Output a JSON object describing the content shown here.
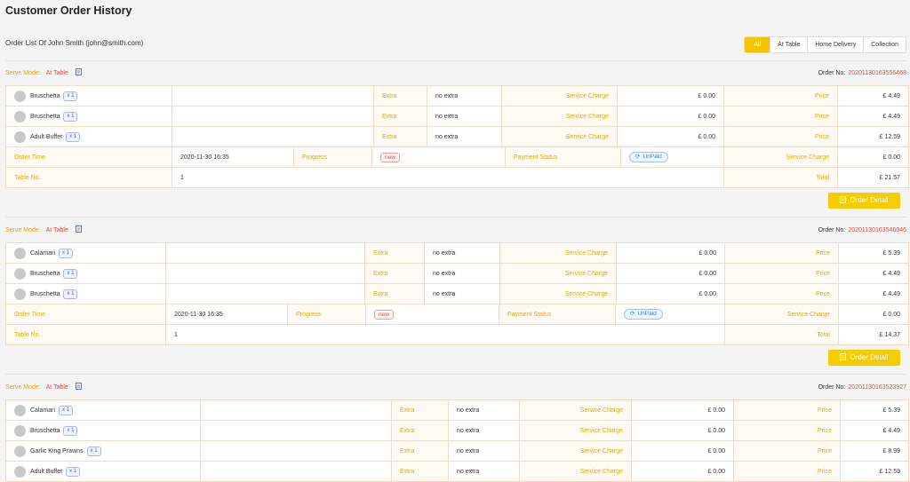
{
  "page": {
    "title": "Customer Order History",
    "subtitle": "Order List Of John Smith (john@smith.com)"
  },
  "filters": [
    {
      "label": "All",
      "active": true
    },
    {
      "label": "At Table",
      "active": false
    },
    {
      "label": "Home Delivery",
      "active": false
    },
    {
      "label": "Collection",
      "active": false
    }
  ],
  "labels": {
    "serve_mode": "Serve Mode:",
    "order_no": "Order No:",
    "extra": "Extra",
    "service_charge": "Service Charge",
    "price": "Price",
    "order_time": "Order Time",
    "progress": "Progress",
    "payment_status": "Payment Status",
    "table_no": "Table No.",
    "total": "Total",
    "order_detail": "Order Detail"
  },
  "icons": {
    "serve_mode": "document-icon",
    "order_detail": "document-icon",
    "unpaid": "refresh-icon",
    "item": "avatar-placeholder-icon"
  },
  "colors": {
    "accent": "#f5cc00",
    "label": "#e6a800",
    "highlight": "#e84a3a",
    "border": "#f0c9a4"
  },
  "orders": [
    {
      "serve_mode": "At Table",
      "order_no": "20201130163556468",
      "items": [
        {
          "name": "Bruschetta",
          "qty": "x 1",
          "extra": "no extra",
          "service_charge": "£ 0.00",
          "price": "£ 4.49"
        },
        {
          "name": "Bruschetta",
          "qty": "x 1",
          "extra": "no extra",
          "service_charge": "£ 0.00",
          "price": "£ 4.49"
        },
        {
          "name": "Adult Buffet",
          "qty": "x 1",
          "extra": "no extra",
          "service_charge": "£ 0.00",
          "price": "£ 12.59"
        }
      ],
      "order_time": "2020-11-30 16:35",
      "progress": "new",
      "payment_status": "UnPaid",
      "service_charge_total": "£ 0.00",
      "table_no": "1",
      "total": "£ 21.57"
    },
    {
      "serve_mode": "At Table",
      "order_no": "20201130163546046",
      "items": [
        {
          "name": "Calamari",
          "qty": "x 1",
          "extra": "no extra",
          "service_charge": "£ 0.00",
          "price": "£ 5.39"
        },
        {
          "name": "Bruschetta",
          "qty": "x 1",
          "extra": "no extra",
          "service_charge": "£ 0.00",
          "price": "£ 4.49"
        },
        {
          "name": "Bruschetta",
          "qty": "x 1",
          "extra": "no extra",
          "service_charge": "£ 0.00",
          "price": "£ 4.49"
        }
      ],
      "order_time": "2020-11-30 16:35",
      "progress": "new",
      "payment_status": "UnPaid",
      "service_charge_total": "£ 0.00",
      "table_no": "1",
      "total": "£ 14.37"
    },
    {
      "serve_mode": "At Table",
      "order_no": "20201130163523927",
      "items": [
        {
          "name": "Calamari",
          "qty": "x 1",
          "extra": "no extra",
          "service_charge": "£ 0.00",
          "price": "£ 5.39"
        },
        {
          "name": "Bruschetta",
          "qty": "x 1",
          "extra": "no extra",
          "service_charge": "£ 0.00",
          "price": "£ 4.49"
        },
        {
          "name": "Garlic King Prawns",
          "qty": "x 1",
          "extra": "no extra",
          "service_charge": "£ 0.00",
          "price": "£ 8.99"
        },
        {
          "name": "Adult Buffet",
          "qty": "x 1",
          "extra": "no extra",
          "service_charge": "£ 0.00",
          "price": "£ 12.59"
        }
      ]
    }
  ]
}
